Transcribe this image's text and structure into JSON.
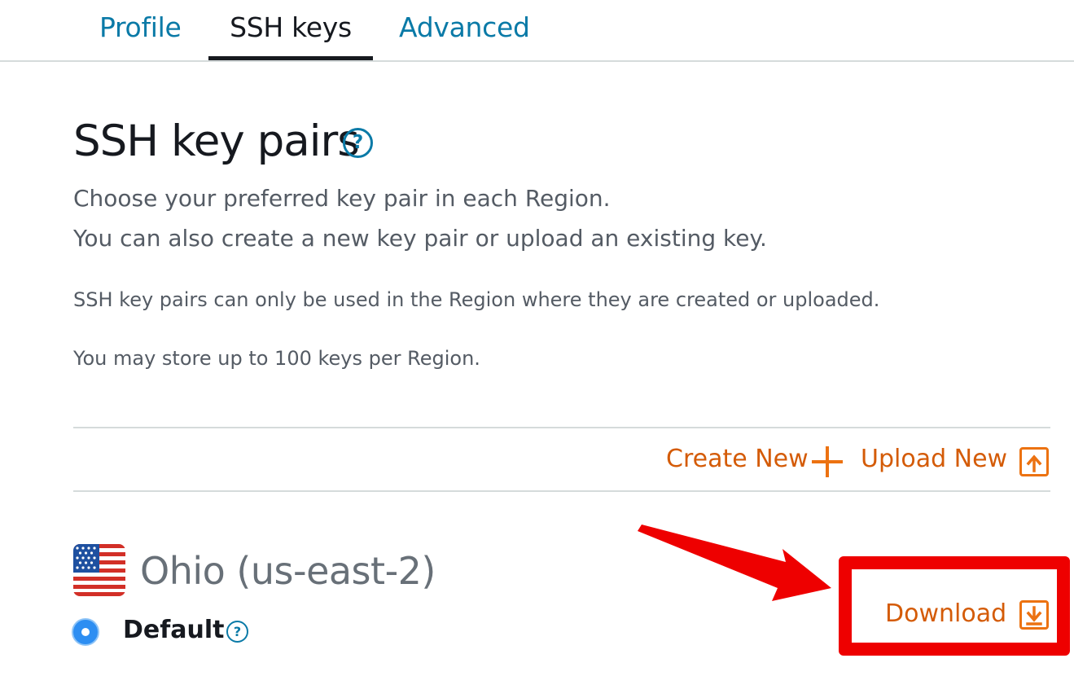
{
  "tabs": [
    {
      "label": "Profile",
      "active": false
    },
    {
      "label": "SSH keys",
      "active": true
    },
    {
      "label": "Advanced",
      "active": false
    }
  ],
  "header": {
    "title": "SSH key pairs",
    "help_icon": "question-circle-icon",
    "help_glyph": "?"
  },
  "description": {
    "line1": "Choose your preferred key pair in each Region.",
    "line2": "You can also create a new key pair or upload an existing key.",
    "note1": "SSH key pairs can only be used in the Region where they are created or uploaded.",
    "note2": "You may store up to 100 keys per Region."
  },
  "actions": {
    "create_label": "Create New",
    "create_icon": "plus-icon",
    "upload_label": "Upload New",
    "upload_icon": "upload-icon"
  },
  "region": {
    "name": "Ohio (us-east-2)",
    "flag_icon": "us-flag-icon",
    "key_name": "Default",
    "key_selected": true,
    "help_glyph": "?",
    "download_label": "Download",
    "download_icon": "download-icon"
  },
  "colors": {
    "link": "#0a7aa7",
    "action": "#ec7211",
    "radio": "#2d8ef2",
    "annotation": "#ee0000"
  }
}
